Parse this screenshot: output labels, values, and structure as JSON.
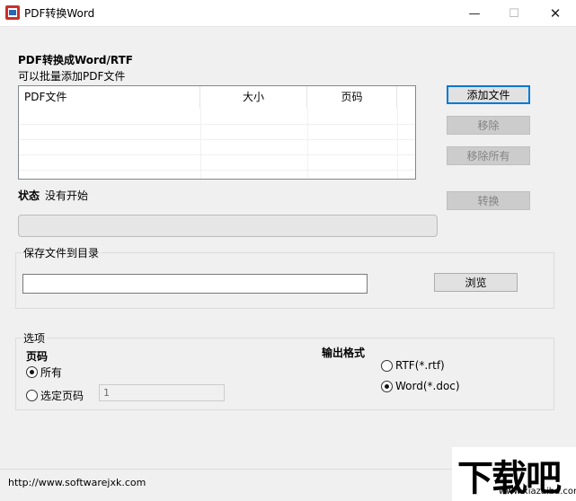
{
  "window": {
    "title": "PDF转换Word",
    "minimize_glyph": "—",
    "maximize_glyph": "☐",
    "close_glyph": "✕"
  },
  "convert_section": {
    "heading": "PDF转换成Word/RTF",
    "hint": "可以批量添加PDF文件",
    "columns": [
      "PDF文件",
      "大小",
      "页码"
    ],
    "rows": []
  },
  "buttons": {
    "add_file": "添加文件",
    "remove": "移除",
    "remove_all": "移除所有",
    "convert": "转换",
    "browse": "浏览"
  },
  "status": {
    "label": "状态",
    "value": "没有开始",
    "progress": 0
  },
  "save_group": {
    "legend": "保存文件到目录",
    "path_value": ""
  },
  "options_group": {
    "legend": "选项",
    "pages_label": "页码",
    "all_pages": "所有",
    "selected_pages": "选定页码",
    "page_input_value": "1",
    "output_format_label": "输出格式",
    "rtf_option": "RTF(*.rtf)",
    "word_option": "Word(*.doc)",
    "pages_mode": "all",
    "output_format": "word"
  },
  "statusbar": {
    "url": "http://www.softwarejxk.com"
  },
  "watermark": {
    "logo_text": "下载吧",
    "url": "www.xiazaiba.com"
  }
}
